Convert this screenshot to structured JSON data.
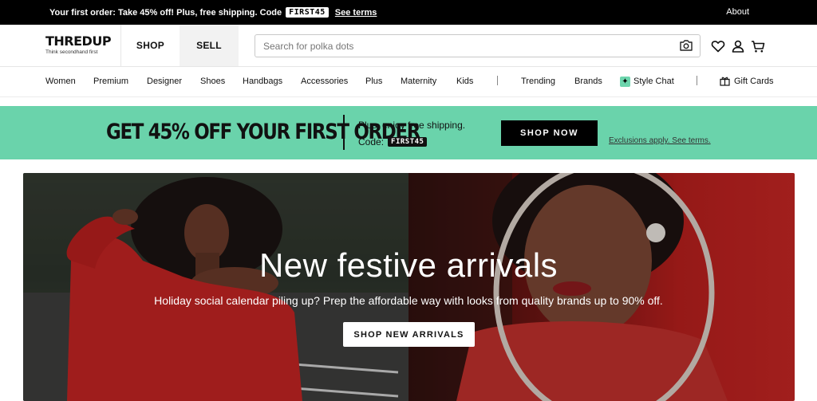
{
  "topbar": {
    "promo_text": "Your first order: Take 45% off! Plus, free shipping. Code",
    "promo_code": "FIRST45",
    "terms_link": "See terms",
    "about_link": "About"
  },
  "header": {
    "logo": {
      "wordmark": "THREDUP",
      "tagline": "Think secondhand first"
    },
    "tabs": {
      "shop": "SHOP",
      "sell": "SELL"
    },
    "search": {
      "placeholder": "Search for polka dots",
      "value": ""
    },
    "icons": [
      "camera-icon",
      "heart-icon",
      "user-icon",
      "cart-icon"
    ]
  },
  "nav": {
    "categories": [
      "Women",
      "Premium",
      "Designer",
      "Shoes",
      "Handbags",
      "Accessories",
      "Plus",
      "Maternity",
      "Kids"
    ],
    "secondary": {
      "trending": "Trending",
      "brands": "Brands",
      "style_chat": "Style Chat",
      "gift_cards": "Gift Cards"
    }
  },
  "promo_banner": {
    "headline": "GET 45% OFF YOUR FIRST ORDER",
    "line1": "Plus, enjoy free shipping.",
    "line2_prefix": "Code:",
    "code": "FIRST45",
    "button": "SHOP NOW",
    "exclusions": "Exclusions apply. See terms.",
    "color": "#6ad3ab"
  },
  "hero": {
    "title": "New festive arrivals",
    "subtitle": "Holiday social calendar piling up? Prep the affordable way with looks from quality brands up to 90% off.",
    "cta": "SHOP NEW ARRIVALS",
    "accent_color": "#c52624"
  }
}
